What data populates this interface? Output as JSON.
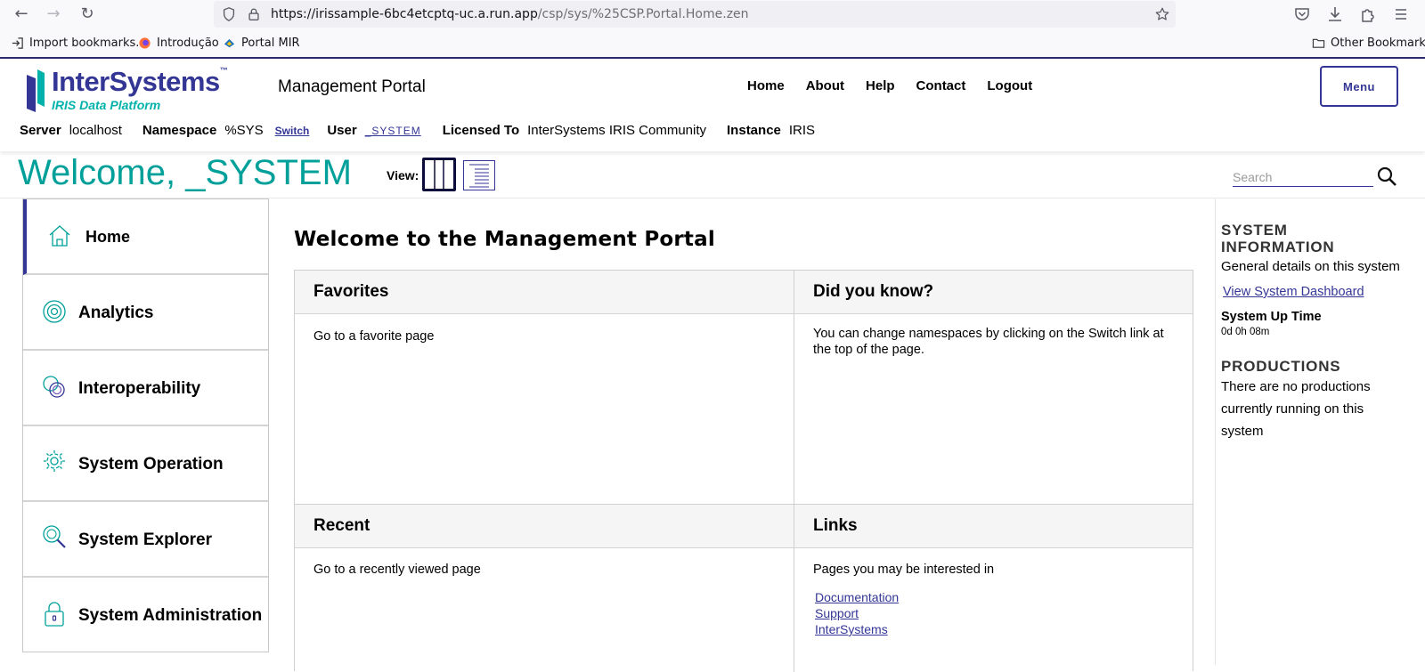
{
  "browser": {
    "url_host": "https://irissample-6bc4etcptq-uc.a.run.app",
    "url_path": "/csp/sys/%25CSP.Portal.Home.zen",
    "bookmarks": [
      "Import bookmarks...",
      "Introdução",
      "Portal MIR"
    ],
    "other_bookmarks": "Other Bookmarks"
  },
  "header": {
    "logo_name": "InterSystems",
    "logo_sub": "IRIS Data Platform",
    "portal_title": "Management Portal",
    "links": [
      "Home",
      "About",
      "Help",
      "Contact",
      "Logout"
    ],
    "menu_label": "Menu",
    "info": {
      "server_label": "Server",
      "server_value": "localhost",
      "namespace_label": "Namespace",
      "namespace_value": "%SYS",
      "switch_label": "Switch",
      "user_label": "User",
      "user_value": "_SYSTEM",
      "licensed_label": "Licensed To",
      "licensed_value": "InterSystems IRIS Community",
      "instance_label": "Instance",
      "instance_value": "IRIS"
    }
  },
  "welcome": {
    "text": "Welcome, _SYSTEM",
    "view_label": "View:",
    "search_placeholder": "Search"
  },
  "sidebar": {
    "items": [
      {
        "label": "Home",
        "icon": "home-icon",
        "active": true
      },
      {
        "label": "Analytics",
        "icon": "analytics-icon"
      },
      {
        "label": "Interoperability",
        "icon": "interoperability-icon"
      },
      {
        "label": "System Operation",
        "icon": "gear-icon"
      },
      {
        "label": "System Explorer",
        "icon": "magnifier-icon"
      },
      {
        "label": "System Administration",
        "icon": "lock-icon"
      }
    ]
  },
  "main": {
    "title": "Welcome to the Management Portal",
    "favorites": {
      "title": "Favorites",
      "text": "Go to a favorite page"
    },
    "did_you_know": {
      "title": "Did you know?",
      "text": "You can change namespaces by clicking on the Switch link at the top of the page."
    },
    "recent": {
      "title": "Recent",
      "text": "Go to a recently viewed page"
    },
    "links": {
      "title": "Links",
      "text": "Pages you may be interested in",
      "items": [
        "Documentation",
        "Support",
        "InterSystems"
      ]
    }
  },
  "right_panel": {
    "system_info_heading": "SYSTEM INFORMATION",
    "system_info_text": "General details on this system",
    "dashboard_link": "View System Dashboard",
    "uptime_label": "System Up Time",
    "uptime_value": "0d 0h 08m",
    "productions_heading": "PRODUCTIONS",
    "productions_text": "There are no productions currently running on this system"
  },
  "colors": {
    "brand": "#333695",
    "accent": "#00a09a"
  }
}
